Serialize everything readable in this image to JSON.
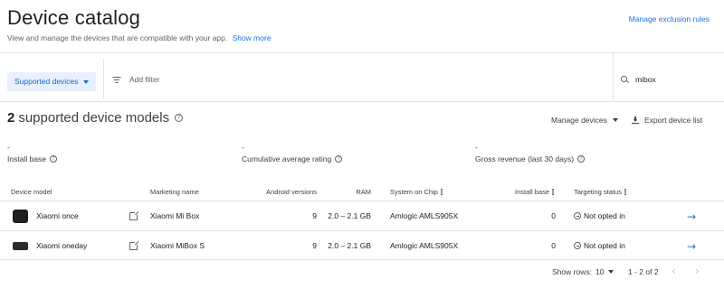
{
  "header": {
    "title": "Device catalog",
    "subtitle": "View and manage the devices that are compatible with your app.",
    "show_more": "Show more",
    "manage_exclusion_rules": "Manage exclusion rules"
  },
  "filter_bar": {
    "chip_label": "Supported devices",
    "add_filter": "Add filter",
    "search_value": "mibox"
  },
  "summary": {
    "count": "2",
    "title": "supported device models",
    "manage_devices": "Manage devices",
    "export": "Export device list"
  },
  "metrics": [
    {
      "value": "-",
      "label": "Install base"
    },
    {
      "value": "-",
      "label": "Cumulative average rating"
    },
    {
      "value": "-",
      "label": "Gross revenue (last 30 days)"
    }
  ],
  "table": {
    "columns": {
      "device_model": "Device model",
      "marketing_name": "Marketing name",
      "android_versions": "Android versions",
      "ram": "RAM",
      "soc": "System on Chip",
      "install_base": "Install base",
      "targeting_status": "Targeting status"
    },
    "rows": [
      {
        "device_model": "Xiaomi once",
        "marketing_name": "Xiaomi Mi Box",
        "android_versions": "9",
        "ram": "2.0 – 2.1 GB",
        "soc": "Amlogic AMLS905X",
        "install_base": "0",
        "targeting_status": "Not opted in"
      },
      {
        "device_model": "Xiaomi oneday",
        "marketing_name": "Xiaomi MiBox S",
        "android_versions": "9",
        "ram": "2.0 – 2.1 GB",
        "soc": "Amlogic AMLS905X",
        "install_base": "0",
        "targeting_status": "Not opted in"
      }
    ]
  },
  "footer": {
    "show_rows_label": "Show rows:",
    "rows_value": "10",
    "range": "1 - 2 of 2"
  },
  "colors": {
    "accent": "#1a73e8",
    "chip_bg": "#e8f0fe",
    "divider": "#e3e3e3"
  }
}
